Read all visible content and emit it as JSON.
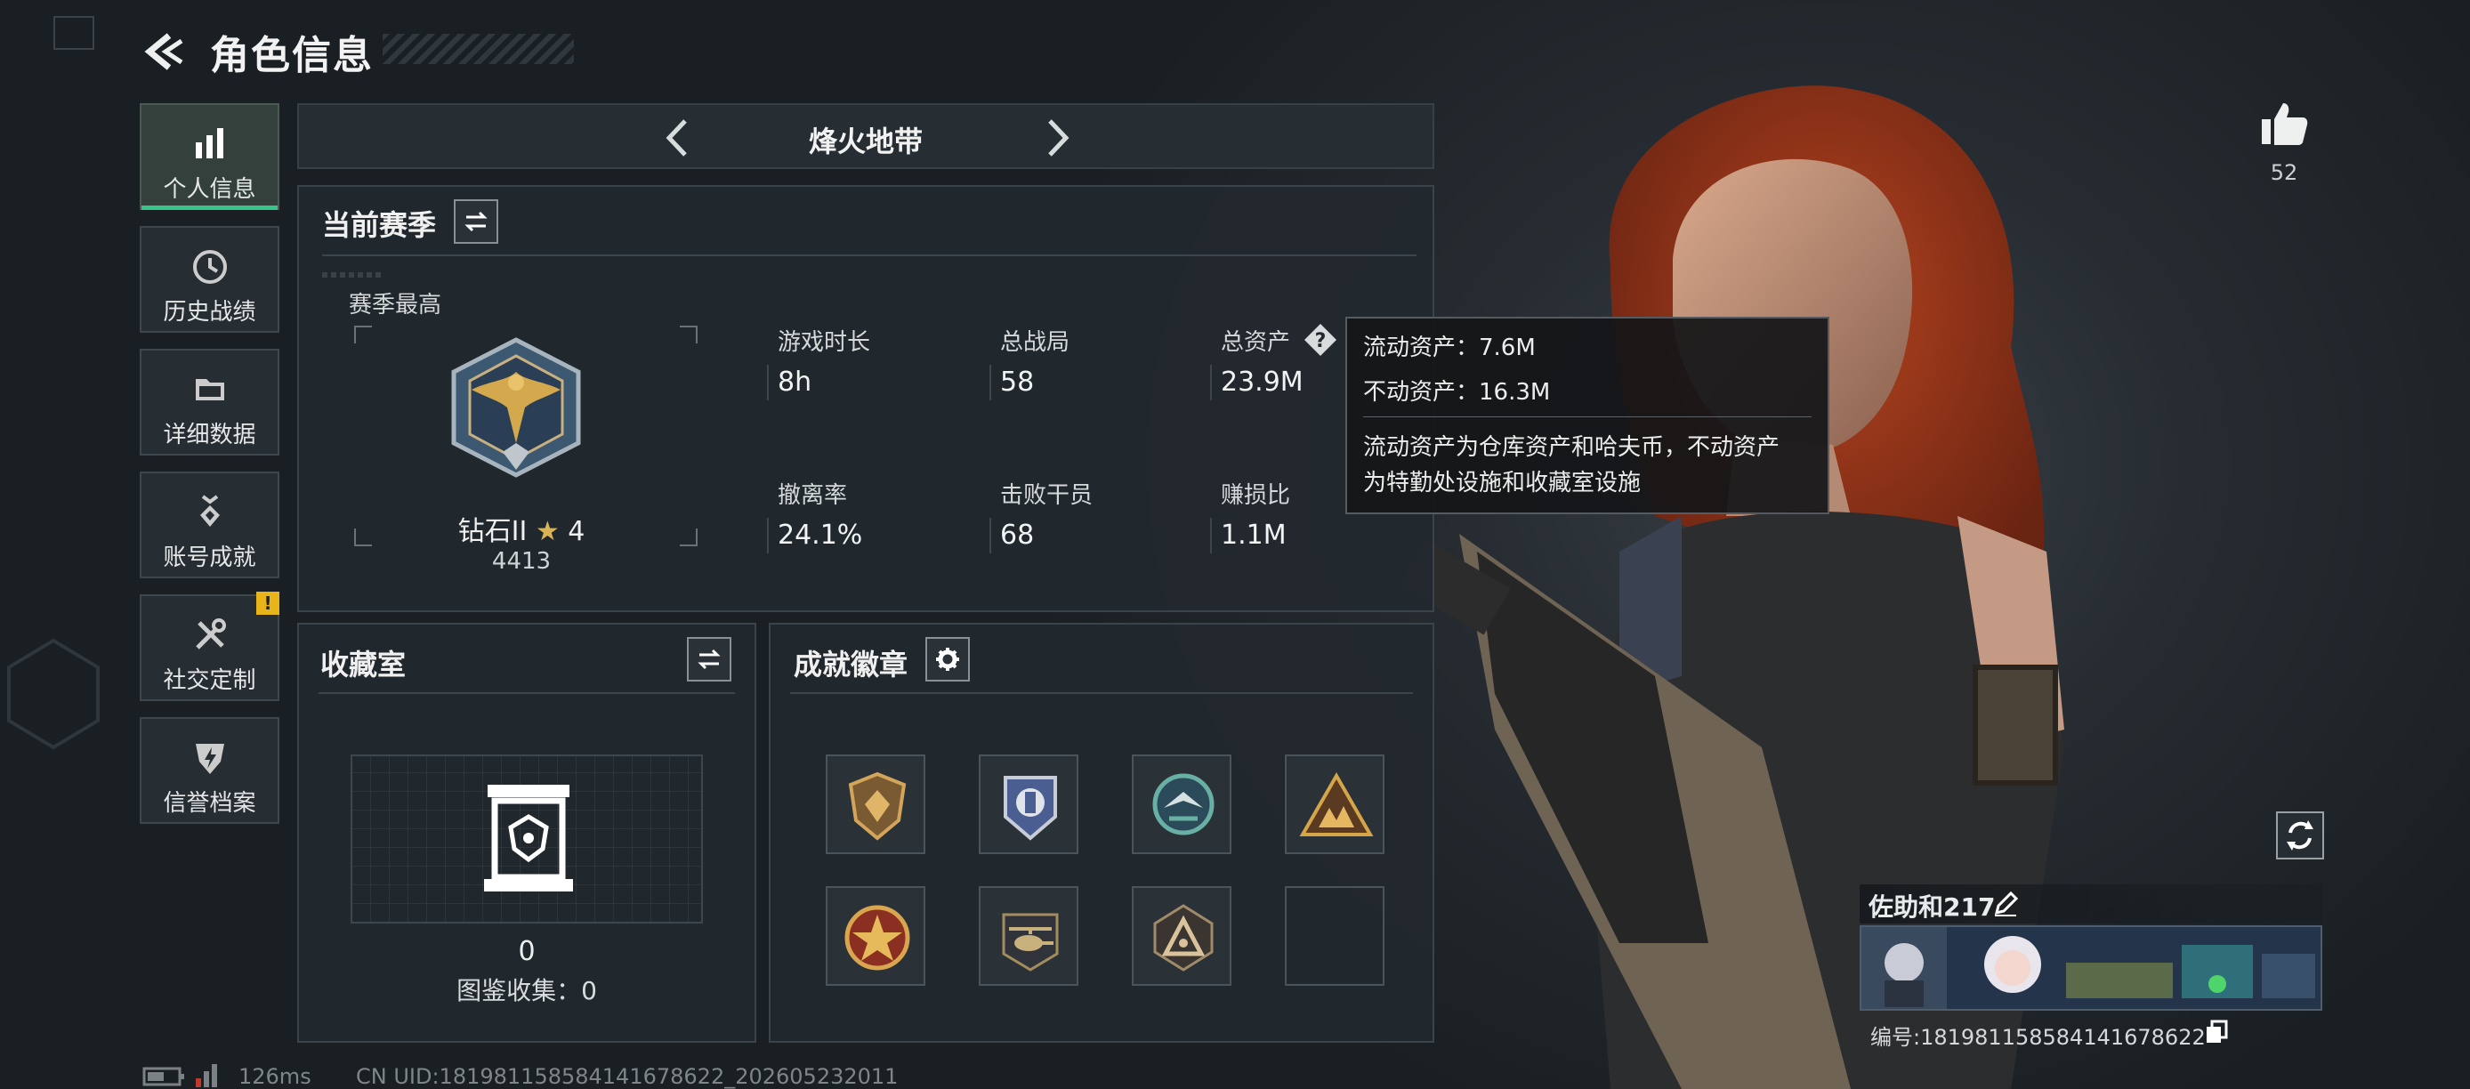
{
  "header": {
    "title": "角色信息"
  },
  "nav": [
    {
      "label": "个人信息",
      "icon": "bar-chart-icon",
      "active": true
    },
    {
      "label": "历史战绩",
      "icon": "clock-icon",
      "active": false
    },
    {
      "label": "详细数据",
      "icon": "folder-icon",
      "active": false
    },
    {
      "label": "账号成就",
      "icon": "medal-icon",
      "active": false
    },
    {
      "label": "社交定制",
      "icon": "tools-icon",
      "active": false,
      "alert": "!"
    },
    {
      "label": "信誉档案",
      "icon": "shield-bolt-icon",
      "active": false
    }
  ],
  "mode": {
    "name": "烽火地带"
  },
  "season": {
    "title": "当前赛季",
    "best_label": "赛季最高",
    "rank": "钻石II",
    "stars": "4",
    "score": "4413",
    "stats": [
      {
        "label": "游戏时长",
        "value": "8h"
      },
      {
        "label": "总战局",
        "value": "58"
      },
      {
        "label": "总资产",
        "value": "23.9M"
      },
      {
        "label": "撤离率",
        "value": "24.1%"
      },
      {
        "label": "击败干员",
        "value": "68"
      },
      {
        "label": "赚损比",
        "value": "1.1M"
      }
    ]
  },
  "tooltip": {
    "liquid": "流动资产：7.6M",
    "fixed": "不动资产：16.3M",
    "desc_line1": "流动资产为仓库资产和哈夫币，不动资产",
    "desc_line2": "为特勤处设施和收藏室设施"
  },
  "collection": {
    "title": "收藏室",
    "count": "0",
    "catalog": "图鉴收集：0"
  },
  "achievements": {
    "title": "成就徽章",
    "badges": [
      "shield-badge-icon",
      "blue-emblem-icon",
      "green-wing-icon",
      "triangle-team-icon",
      "red-star-icon",
      "helicopter-icon",
      "triangle-mark-icon",
      "empty-slot"
    ]
  },
  "player": {
    "likes": "52",
    "name": "佐助和217",
    "id_label": "编号:181981158584141678622"
  },
  "footer": {
    "ping": "126ms",
    "uid": "CN UID:181981158584141678622_202605232011"
  },
  "colors": {
    "accent": "#37c58a",
    "warning": "#e7b41a",
    "panel": "#22292f"
  }
}
